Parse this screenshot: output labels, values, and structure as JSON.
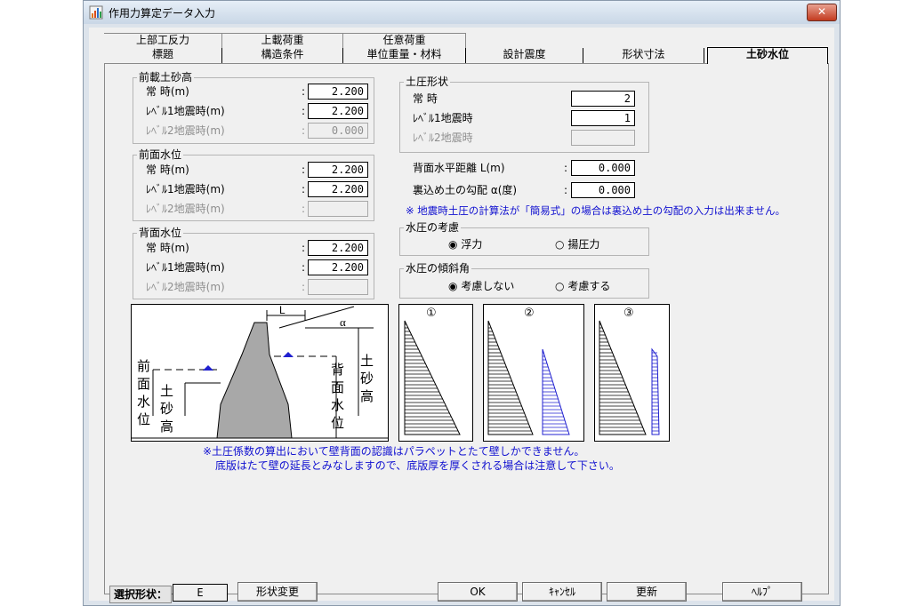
{
  "window": {
    "title": "作用力算定データ入力",
    "close_label": "✕"
  },
  "tabs": {
    "back_row": [
      {
        "label": "上部工反力"
      },
      {
        "label": "上載荷重"
      },
      {
        "label": "任意荷重"
      }
    ],
    "front_row": [
      {
        "label": "標題"
      },
      {
        "label": "構造条件"
      },
      {
        "label": "単位重量・材料"
      },
      {
        "label": "設計震度"
      },
      {
        "label": "形状寸法"
      },
      {
        "label": "土砂水位"
      }
    ],
    "active": "土砂水位"
  },
  "groups": {
    "front_soil": {
      "legend": "前載土砂高",
      "rows": [
        {
          "label": "常  時(m)",
          "value": "2.200",
          "enabled": true
        },
        {
          "label": "ﾚﾍﾞﾙ1地震時(m)",
          "value": "2.200",
          "enabled": true
        },
        {
          "label": "ﾚﾍﾞﾙ2地震時(m)",
          "value": "0.000",
          "enabled": false
        }
      ]
    },
    "front_water": {
      "legend": "前面水位",
      "rows": [
        {
          "label": "常  時(m)",
          "value": "2.200",
          "enabled": true
        },
        {
          "label": "ﾚﾍﾞﾙ1地震時(m)",
          "value": "2.200",
          "enabled": true
        },
        {
          "label": "ﾚﾍﾞﾙ2地震時(m)",
          "value": "",
          "enabled": false
        }
      ]
    },
    "back_water": {
      "legend": "背面水位",
      "rows": [
        {
          "label": "常  時(m)",
          "value": "2.200",
          "enabled": true
        },
        {
          "label": "ﾚﾍﾞﾙ1地震時(m)",
          "value": "2.200",
          "enabled": true
        },
        {
          "label": "ﾚﾍﾞﾙ2地震時(m)",
          "value": "",
          "enabled": false
        }
      ]
    },
    "earth_pressure_shape": {
      "legend": "土圧形状",
      "rows": [
        {
          "label": "常  時",
          "value": "2",
          "enabled": true
        },
        {
          "label": "ﾚﾍﾞﾙ1地震時",
          "value": "1",
          "enabled": true
        },
        {
          "label": "ﾚﾍﾞﾙ2地震時",
          "value": "",
          "enabled": false
        }
      ]
    }
  },
  "colon": ":",
  "back_distance": {
    "label": "背面水平距離  L(m)",
    "value": "0.000"
  },
  "backfill_slope": {
    "label": "裏込め土の勾配 α(度)",
    "value": "0.000"
  },
  "note_slope": "※ 地震時土圧の計算法が「簡易式」の場合は裏込め土の勾配の入力は出来ません。",
  "water_consider": {
    "legend": "水圧の考慮",
    "options": [
      {
        "label": "浮力",
        "selected": true
      },
      {
        "label": "揚圧力",
        "selected": false
      }
    ]
  },
  "water_slope": {
    "legend": "水圧の傾斜角",
    "options": [
      {
        "label": "考慮しない",
        "selected": true
      },
      {
        "label": "考慮する",
        "selected": false
      }
    ]
  },
  "radio_on": "◉",
  "radio_off": "○",
  "cross_section": {
    "dim_L": "L",
    "dim_alpha": "α",
    "label_front_water": "前面水位",
    "label_soil_height_front": "土砂高",
    "label_back_water": "背面水位",
    "label_soil_height_back": "土砂高"
  },
  "pressure_shapes": [
    {
      "number": "①"
    },
    {
      "number": "②"
    },
    {
      "number": "③"
    }
  ],
  "colors": {
    "hatch_black": "#000000",
    "hatch_blue": "#2020d0",
    "note_blue": "#1010d0"
  },
  "notes_bottom": [
    "※土圧係数の算出において壁背面の認識はパラペットとたて壁しかできません。",
    "底版はたて壁の延長とみなしますので、底版厚を厚くされる場合は注意して下さい。"
  ],
  "footer": {
    "selected_shape_label": "選択形状：",
    "selected_shape_value": "E",
    "change_shape_button": "形状変更",
    "ok_button": "OK",
    "cancel_button": "ｷｬﾝｾﾙ",
    "update_button": "更新",
    "help_button": "ﾍﾙﾌﾟ"
  }
}
